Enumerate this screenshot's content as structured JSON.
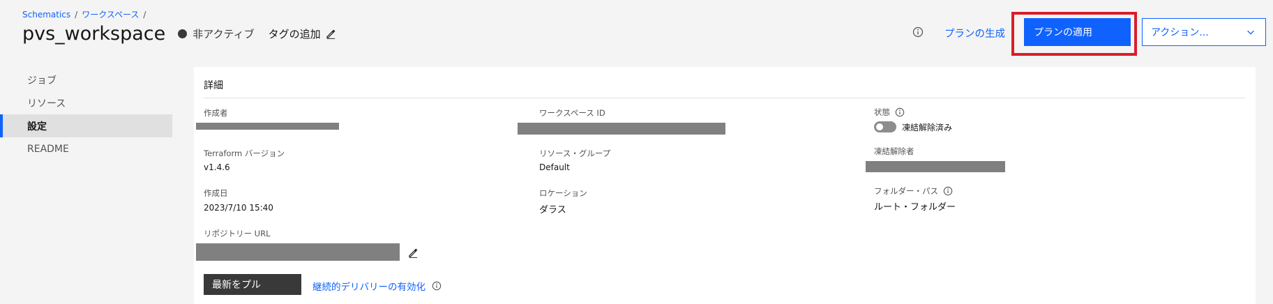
{
  "breadcrumb": {
    "root": "Schematics",
    "sep": "/",
    "workspaces": "ワークスペース",
    "trail": "/"
  },
  "header": {
    "title": "pvs_workspace",
    "status": "非アクティブ",
    "add_tag": "タグの追加",
    "generate_plan": "プランの生成",
    "apply_plan": "プランの適用",
    "actions": "アクション..."
  },
  "sidebar": {
    "items": [
      {
        "label": "ジョブ",
        "active": false
      },
      {
        "label": "リソース",
        "active": false
      },
      {
        "label": "設定",
        "active": true
      },
      {
        "label": "README",
        "active": false
      }
    ]
  },
  "details": {
    "title": "詳細",
    "creator_label": "作成者",
    "workspace_id_label": "ワークスペース ID",
    "state_label": "状態",
    "state_value": "凍結解除済み",
    "terraform_label": "Terraform バージョン",
    "terraform_value": "v1.4.6",
    "resource_group_label": "リソース・グループ",
    "resource_group_value": "Default",
    "unfrozen_by_label": "凍結解除者",
    "created_label": "作成日",
    "created_value": "2023/7/10 15:40",
    "location_label": "ロケーション",
    "location_value": "ダラス",
    "folder_path_label": "フォルダー・パス",
    "folder_path_value": "ルート・フォルダー",
    "repo_url_label": "リポジトリー URL",
    "pull_latest": "最新をプル",
    "enable_cd": "継続的デリバリーの有効化"
  },
  "colors": {
    "accent": "#0f62fe",
    "highlight": "#da1e28",
    "redaction": "#808080"
  }
}
